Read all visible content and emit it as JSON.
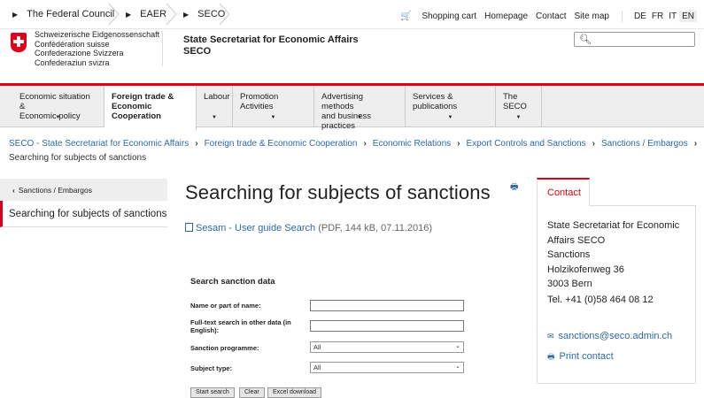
{
  "topbar": {
    "crumbs": [
      "The Federal Council",
      "EAER",
      "SECO"
    ],
    "links": {
      "cart": "Shopping cart",
      "homepage": "Homepage",
      "contact": "Contact",
      "sitemap": "Site map"
    },
    "languages": [
      "DE",
      "FR",
      "IT",
      "EN"
    ],
    "active_language": "EN"
  },
  "header": {
    "confed_lines": [
      "Schweizerische Eidgenossenschaft",
      "Confédération suisse",
      "Confederazione Svizzera",
      "Confederaziun svizra"
    ],
    "org_line1": "State Secretariat for Economic Affairs",
    "org_line2": "SECO",
    "search_placeholder": ""
  },
  "nav": {
    "items": [
      {
        "label1": "Economic situation &",
        "label2": "Economic policy",
        "label3": ""
      },
      {
        "label1": "Foreign trade &",
        "label2": "Economic",
        "label3": "Cooperation"
      },
      {
        "label1": "Labour",
        "label2": "",
        "label3": ""
      },
      {
        "label1": "Promotion Activities",
        "label2": "",
        "label3": ""
      },
      {
        "label1": "Advertising methods",
        "label2": "and business practices",
        "label3": ""
      },
      {
        "label1": "Services & publications",
        "label2": "",
        "label3": ""
      },
      {
        "label1": "The SECO",
        "label2": "",
        "label3": ""
      }
    ]
  },
  "breadcrumb": {
    "items": [
      "SECO - State Secretariat for Economic Affairs",
      "Foreign trade & Economic Cooperation",
      "Economic Relations",
      "Export Controls and Sanctions",
      "Sanctions / Embargos"
    ],
    "current": "Searching for subjects of sanctions"
  },
  "sidebar": {
    "back_label": "Sanctions / Embargos",
    "current_label": "Searching for subjects of sanctions"
  },
  "main": {
    "title": "Searching for subjects of sanctions",
    "pdf_link": "Sesam - User guide Search",
    "pdf_meta": "(PDF, 144 kB, 07.11.2016)",
    "form": {
      "title": "Search sanction data",
      "name_label": "Name or part of name:",
      "fulltext_label1": "Full-text search in other data (in",
      "fulltext_label2": "English):",
      "programme_label": "Sanction programme:",
      "programme_value": "All",
      "subject_label": "Subject type:",
      "subject_value": "All",
      "btn_search": "Start search",
      "btn_clear": "Clear",
      "btn_excel": "Excel download"
    }
  },
  "contact": {
    "tab_label": "Contact",
    "address": [
      "State Secretariat for Economic",
      "Affairs SECO",
      "Sanctions",
      "Holzikofenweg 36",
      "3003 Bern"
    ],
    "tel": "Tel. +41 (0)58 464 08 12",
    "email": "sanctions@seco.admin.ch",
    "print": "Print contact"
  },
  "colors": {
    "accent_red": "#dc0018",
    "link_blue": "#2f68a5",
    "nav_bg": "#eeeeee"
  }
}
